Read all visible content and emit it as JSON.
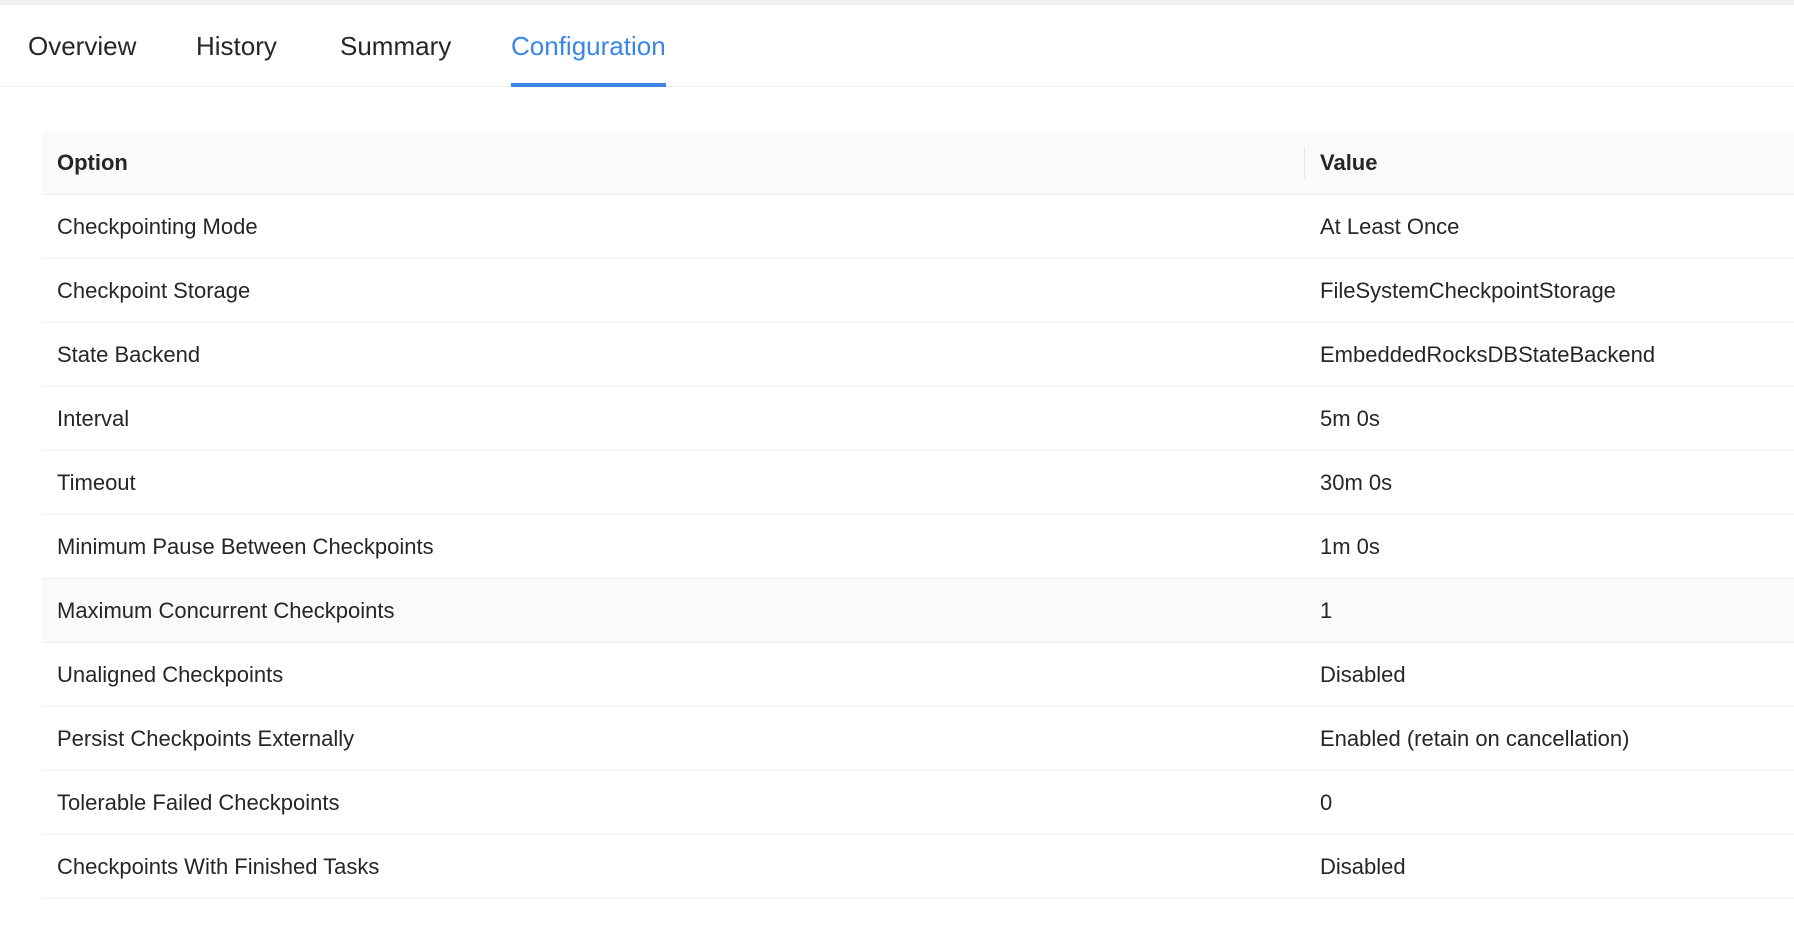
{
  "tabs": [
    {
      "label": "Overview",
      "active": false
    },
    {
      "label": "History",
      "active": false
    },
    {
      "label": "Summary",
      "active": false
    },
    {
      "label": "Configuration",
      "active": true
    }
  ],
  "table": {
    "columns": {
      "option": "Option",
      "value": "Value"
    },
    "rows": [
      {
        "option": "Checkpointing Mode",
        "value": "At Least Once"
      },
      {
        "option": "Checkpoint Storage",
        "value": "FileSystemCheckpointStorage"
      },
      {
        "option": "State Backend",
        "value": "EmbeddedRocksDBStateBackend"
      },
      {
        "option": "Interval",
        "value": "5m 0s"
      },
      {
        "option": "Timeout",
        "value": "30m 0s"
      },
      {
        "option": "Minimum Pause Between Checkpoints",
        "value": "1m 0s"
      },
      {
        "option": "Maximum Concurrent Checkpoints",
        "value": "1"
      },
      {
        "option": "Unaligned Checkpoints",
        "value": "Disabled"
      },
      {
        "option": "Persist Checkpoints Externally",
        "value": "Enabled (retain on cancellation)"
      },
      {
        "option": "Tolerable Failed Checkpoints",
        "value": "0"
      },
      {
        "option": "Checkpoints With Finished Tasks",
        "value": "Disabled"
      }
    ]
  },
  "colors": {
    "accent": "#3a86e8",
    "text": "#262626",
    "header_bg": "#fafafa",
    "border": "#f0f0f0"
  }
}
